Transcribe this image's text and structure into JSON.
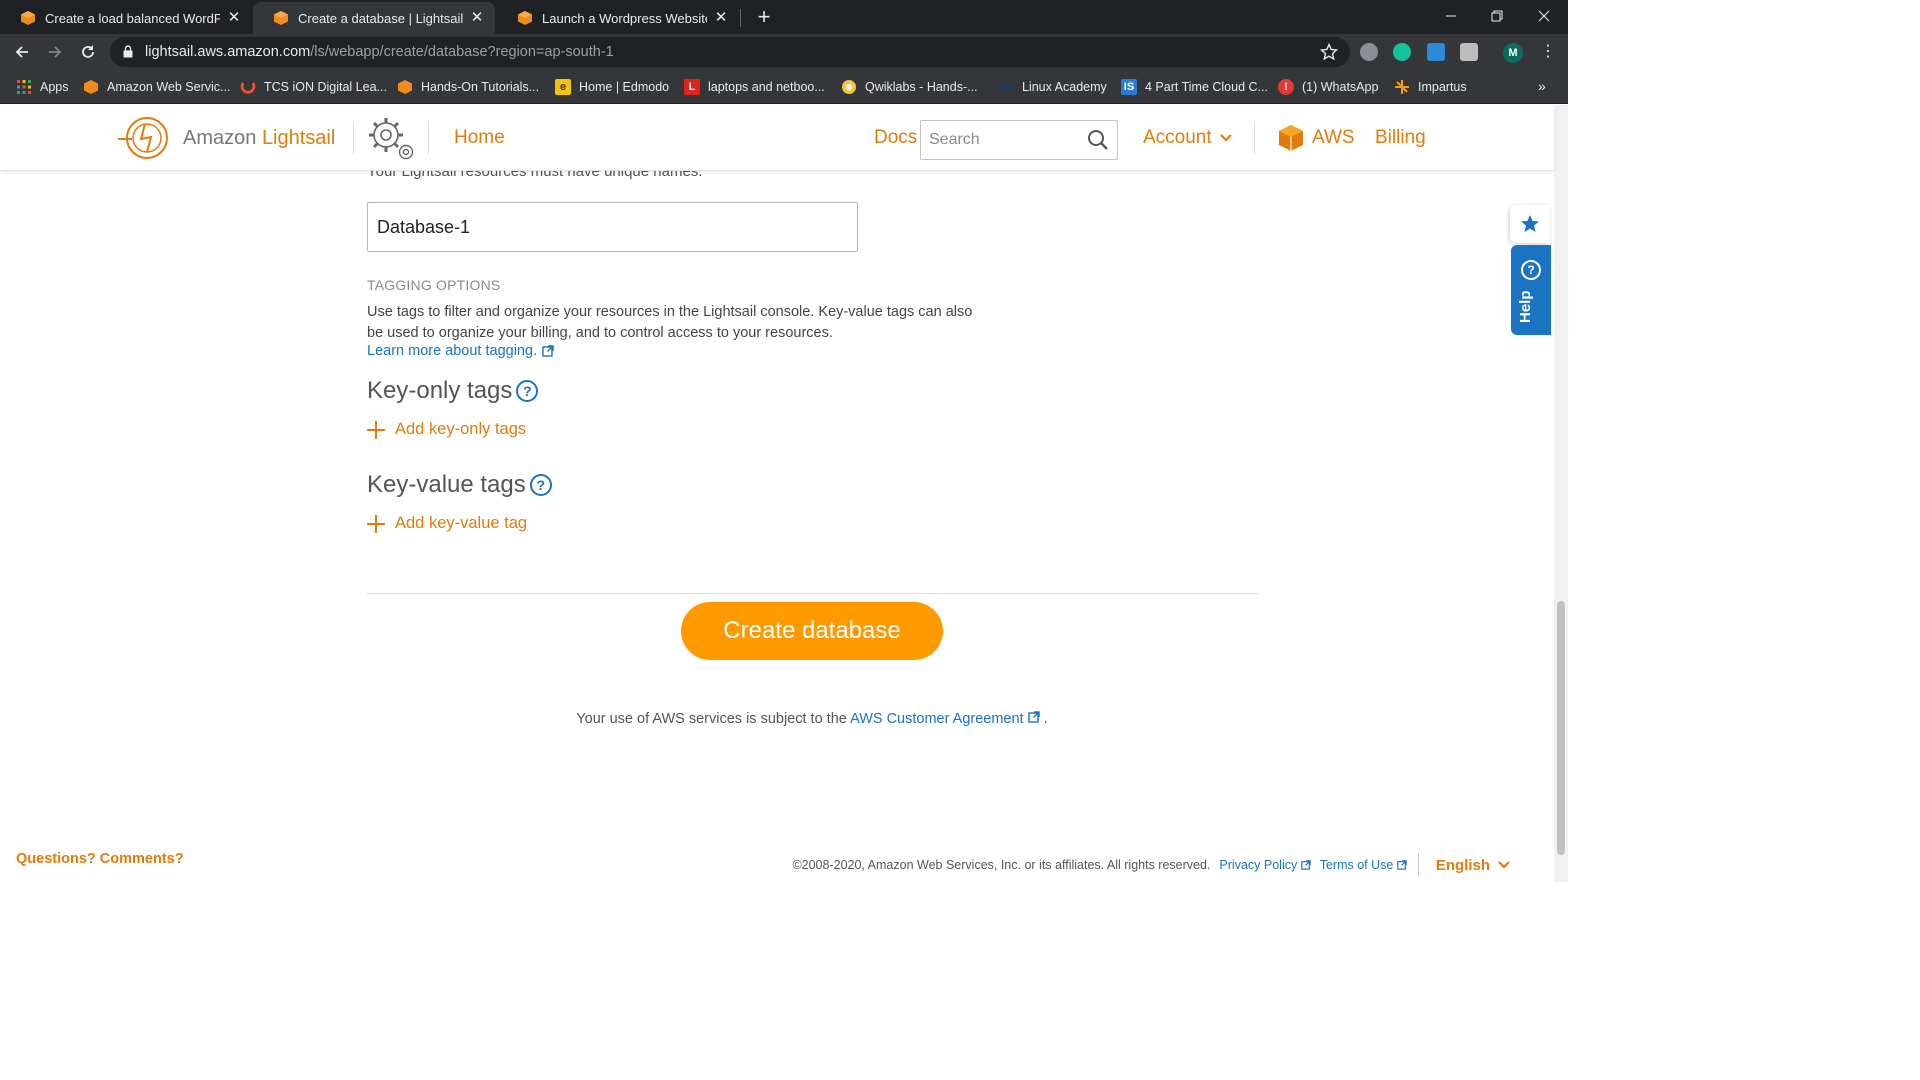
{
  "browser": {
    "tabs": [
      {
        "title": "Create a load balanced WordPress",
        "active": false
      },
      {
        "title": "Create a database | Lightsail",
        "active": true
      },
      {
        "title": "Launch a Wordpress Website",
        "active": false
      }
    ],
    "url_host": "lightsail.aws.amazon.com",
    "url_path": "/ls/webapp/create/database?region=ap-south-1",
    "profile_initial": "M",
    "bookmarks": [
      {
        "label": "Apps",
        "icon": "apps-grid-icon"
      },
      {
        "label": "Amazon Web Servic...",
        "icon": "aws-cube-icon"
      },
      {
        "label": "TCS iON Digital Lea...",
        "icon": "tcs-ion-icon"
      },
      {
        "label": "Hands-On Tutorials...",
        "icon": "aws-cube-icon"
      },
      {
        "label": "Home | Edmodo",
        "icon": "edmodo-icon"
      },
      {
        "label": "laptops and netboo...",
        "icon": "lenovo-icon"
      },
      {
        "label": "Qwiklabs - Hands-...",
        "icon": "qwiklabs-icon"
      },
      {
        "label": "Linux Academy",
        "icon": "linux-academy-icon"
      },
      {
        "label": "4 Part Time Cloud C...",
        "icon": "is-icon"
      },
      {
        "label": "(1) WhatsApp",
        "icon": "whatsapp-icon"
      },
      {
        "label": "Impartus",
        "icon": "impartus-icon"
      }
    ],
    "bookmarks_more": "»"
  },
  "header": {
    "brand_prefix": "Amazon",
    "brand_accent": "Lightsail",
    "home": "Home",
    "docs": "Docs",
    "search_placeholder": "Search",
    "account": "Account",
    "aws": "AWS",
    "billing": "Billing"
  },
  "form": {
    "cut_text": "Your Lightsail resources must have unique names.",
    "name_value": "Database-1",
    "tagging_label": "TAGGING OPTIONS",
    "tagging_desc": "Use tags to filter and organize your resources in the Lightsail console. Key-value tags can also be used to organize your billing, and to control access to your resources.",
    "learn_more": "Learn more about tagging.",
    "key_only_heading": "Key-only tags",
    "add_key_only": "Add key-only tags",
    "key_value_heading": "Key-value tags",
    "add_key_value": "Add key-value tag",
    "help_glyph": "?",
    "create_button": "Create database",
    "agreement_prefix": "Your use of AWS services is subject to the",
    "agreement_link": "AWS Customer Agreement",
    "agreement_suffix": "."
  },
  "footer": {
    "questions": "Questions? Comments?",
    "copyright": "©2008-2020, Amazon Web Services, Inc. or its affiliates. All rights reserved.",
    "privacy": "Privacy Policy",
    "terms": "Terms of Use",
    "language": "English"
  },
  "widgets": {
    "help": "Help"
  },
  "colors": {
    "accent_orange": "#e07c0c",
    "button_orange": "#ff9900",
    "link_blue": "#1b73c4",
    "chrome_dark": "#202124",
    "chrome_toolbar": "#35363a"
  }
}
